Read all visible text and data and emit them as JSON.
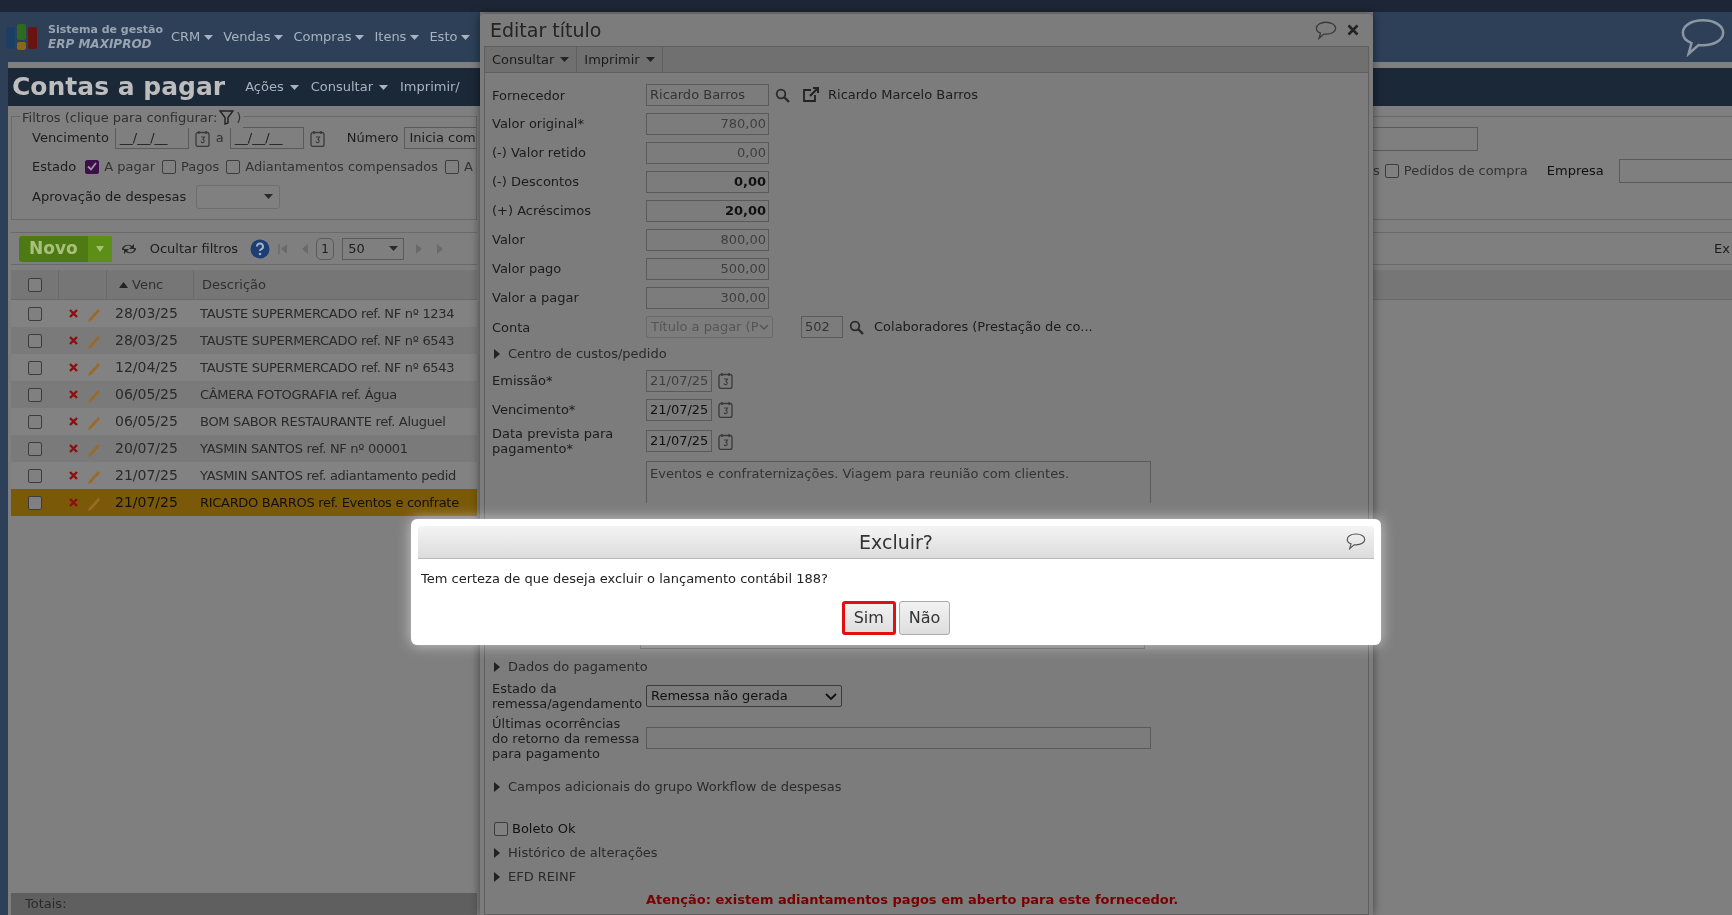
{
  "header": {
    "logo_line1": "Sistema de gestão",
    "logo_line2": "ERP MAXIPROD",
    "menu": [
      "CRM",
      "Vendas",
      "Compras",
      "Itens",
      "Esto"
    ]
  },
  "page": {
    "title": "Contas a pagar",
    "menu": [
      "Ações",
      "Consultar",
      "Imprimir/"
    ]
  },
  "filters": {
    "legend": "Filtros (clique para configurar:",
    "legend_end": ")",
    "due_label": "Vencimento",
    "due_from": "__/__/__",
    "due_sep": "a",
    "due_to": "__/__/__",
    "number_label": "Número",
    "number_value": "Inicia com",
    "status_label": "Estado",
    "status_options": [
      {
        "label": "A pagar",
        "checked": true
      },
      {
        "label": "Pagos",
        "checked": false
      },
      {
        "label": "Adiantamentos compensados",
        "checked": false
      },
      {
        "label": "A",
        "checked": false
      }
    ],
    "approval_label": "Aprovação de despesas",
    "right_partial": "s",
    "right_option": {
      "label": "Pedidos de compra",
      "checked": false
    },
    "company_label": "Empresa"
  },
  "toolbar": {
    "new_button": "Novo",
    "hide_filters": "Ocultar filtros",
    "page": "1",
    "page_size": "50",
    "right_text": "Ex"
  },
  "table": {
    "select_all_checked": false,
    "columns": [
      "Venc",
      "Descrição"
    ],
    "rows": [
      {
        "date": "28/03/25",
        "description": "TAUSTE SUPERMERCADO ref. NF nº 1234",
        "selected": false
      },
      {
        "date": "28/03/25",
        "description": "TAUSTE SUPERMERCADO ref. NF nº 6543",
        "selected": false
      },
      {
        "date": "12/04/25",
        "description": "TAUSTE SUPERMERCADO ref. NF nº 6543",
        "selected": false
      },
      {
        "date": "06/05/25",
        "description": "CÂMERA FOTOGRAFIA ref. Água",
        "selected": false
      },
      {
        "date": "06/05/25",
        "description": "BOM SABOR RESTAURANTE ref. Aluguel",
        "selected": false
      },
      {
        "date": "20/07/25",
        "description": "YASMIN SANTOS ref. NF nº 00001",
        "selected": false
      },
      {
        "date": "21/07/25",
        "description": "YASMIN SANTOS ref. adiantamento pedid",
        "selected": false
      },
      {
        "date": "21/07/25",
        "description": "RICARDO BARROS ref. Eventos e confrate",
        "selected": true
      }
    ],
    "footer": "Totais:"
  },
  "modal": {
    "title": "Editar título",
    "menu": [
      "Consultar",
      "Imprimir"
    ],
    "fields_top": [
      {
        "kind": "supplier",
        "label": "Fornecedor",
        "value": "Ricardo Barros",
        "link_text": "Ricardo Marcelo Barros"
      },
      {
        "kind": "amount",
        "label": "Valor original*",
        "value": "780,00",
        "disabled": true
      },
      {
        "kind": "amount",
        "label": "(-) Valor retido",
        "value": "0,00",
        "disabled": true
      },
      {
        "kind": "amount",
        "label": "(-) Descontos",
        "value": "0,00",
        "disabled": false
      },
      {
        "kind": "amount",
        "label": "(+) Acréscimos",
        "value": "20,00",
        "disabled": false
      },
      {
        "kind": "amount",
        "label": "Valor",
        "value": "800,00",
        "disabled": true
      },
      {
        "kind": "amount",
        "label": "Valor pago",
        "value": "500,00",
        "disabled": true
      },
      {
        "kind": "amount",
        "label": "Valor a pagar",
        "value": "300,00",
        "disabled": true
      },
      {
        "kind": "account",
        "label": "Conta",
        "value": "Título a pagar (P",
        "code": "502",
        "description": "Colaboradores (Prestação de co..."
      },
      {
        "kind": "section",
        "label": "Centro de custos/pedido"
      },
      {
        "kind": "date",
        "label": "Emissão*",
        "value": "21/07/25",
        "disabled": true
      },
      {
        "kind": "date",
        "label": "Vencimento*",
        "value": "21/07/25",
        "disabled": false
      },
      {
        "kind": "date",
        "label": "Data prevista para pagamento*",
        "value": "21/07/25",
        "disabled": false
      },
      {
        "kind": "textarea",
        "value": "Eventos e confraternizações. Viagem para reunião com clientes."
      }
    ],
    "fields_bottom": [
      {
        "kind": "section",
        "label": "Dados do pagamento"
      },
      {
        "kind": "select",
        "label": "Estado da remessa/agendamento",
        "value": "Remessa não gerada"
      },
      {
        "kind": "text",
        "label": "Últimas ocorrências do retorno da remessa para pagamento"
      },
      {
        "kind": "section",
        "label": "Campos adicionais do grupo Workflow de despesas"
      },
      {
        "kind": "checkbox",
        "label": "Boleto Ok",
        "checked": false
      },
      {
        "kind": "section",
        "label": "Histórico de alterações"
      },
      {
        "kind": "section",
        "label": "EFD REINF"
      },
      {
        "kind": "warning",
        "label": "Atenção: existem adiantamentos pagos em aberto para este fornecedor."
      }
    ]
  },
  "confirm": {
    "title": "Excluir?",
    "message": "Tem certeza de que deseja excluir o lançamento contábil 188?",
    "buttons": [
      {
        "label": "Sim",
        "focused": true
      },
      {
        "label": "Não",
        "focused": false
      }
    ]
  }
}
